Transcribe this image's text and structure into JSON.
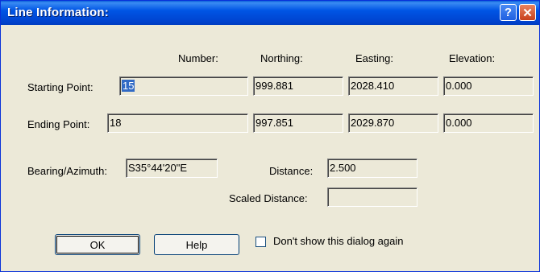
{
  "window": {
    "title": "Line Information:",
    "help_glyph": "?",
    "close_glyph": "✕"
  },
  "columns": {
    "number": "Number:",
    "northing": "Northing:",
    "easting": "Easting:",
    "elevation": "Elevation:"
  },
  "starting_point": {
    "label": "Starting Point:",
    "number": "15",
    "northing": "999.881",
    "easting": "2028.410",
    "elevation": "0.000"
  },
  "ending_point": {
    "label": "Ending Point:",
    "number": "18",
    "northing": "997.851",
    "easting": "2029.870",
    "elevation": "0.000"
  },
  "bearing": {
    "label": "Bearing/Azimuth:",
    "value": "S35°44'20\"E"
  },
  "distance": {
    "label": "Distance:",
    "value": "2.500"
  },
  "scaled_distance": {
    "label": "Scaled Distance:",
    "value": ""
  },
  "buttons": {
    "ok": "OK",
    "help": "Help"
  },
  "dont_show": {
    "label": "Don't show this dialog again",
    "checked": false
  }
}
